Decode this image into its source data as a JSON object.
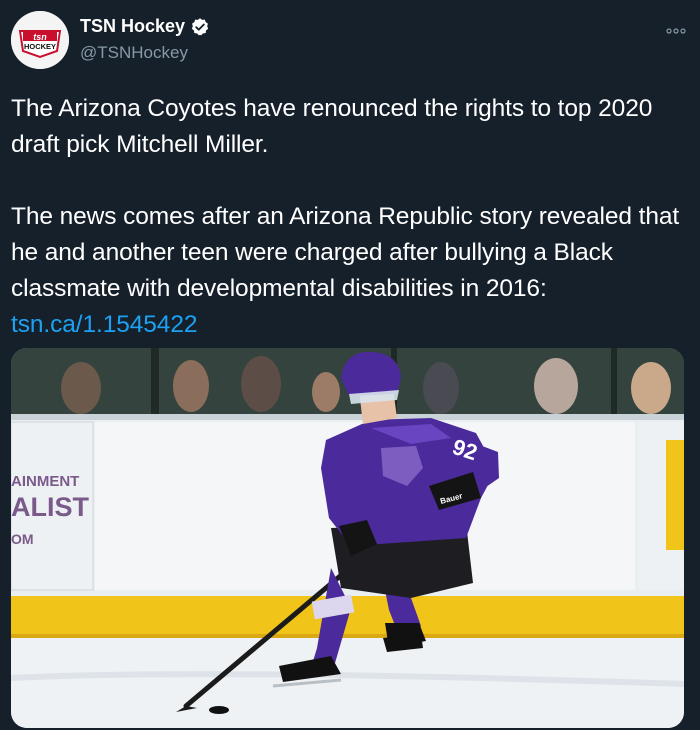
{
  "account": {
    "display_name": "TSN Hockey",
    "handle": "@TSNHockey",
    "avatar_logo_top": "tsn",
    "avatar_logo_bottom": "HOCKEY",
    "verified": true
  },
  "tweet": {
    "paragraph1": "The Arizona Coyotes have renounced the rights to top 2020 draft pick Mitchell Miller.",
    "paragraph2": "The news comes after an Arizona Republic story revealed that he and another teen were charged after bullying a Black classmate with developmental disabilities in 2016:",
    "link_text": "tsn.ca/1.1545422"
  },
  "media": {
    "board_ad_lines": [
      "AINMENT",
      "ALIST",
      "OM"
    ],
    "jersey_number": "92",
    "glove_brand": "Bauer"
  },
  "colors": {
    "background": "#15202b",
    "link": "#1da1f2",
    "secondary_text": "#8899a6",
    "jersey": "#4b2a9c",
    "board_yellow": "#f0c419"
  }
}
